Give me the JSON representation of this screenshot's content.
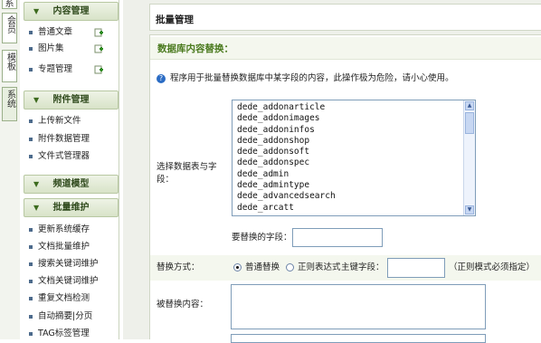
{
  "vertical_tabs": [
    "系",
    "会员",
    "模板",
    "系统"
  ],
  "sidebar": {
    "groups": [
      {
        "title": "内容管理",
        "items": [
          "普通文章",
          "图片集",
          "专题管理"
        ]
      },
      {
        "title": "附件管理",
        "items": [
          "上传新文件",
          "附件数据管理",
          "文件式管理器"
        ]
      },
      {
        "title": "频道模型",
        "items": []
      },
      {
        "title": "批量维护",
        "items": [
          "更新系统缓存",
          "文档批量维护",
          "搜索关键词维护",
          "文档关键词维护",
          "重复文档检测",
          "自动摘要|分页",
          "TAG标签管理"
        ]
      }
    ],
    "collapse_icon": "double-chevron-down-icon",
    "item_icon": "square-bullet-icon",
    "add_icon": "green-plus-icon"
  },
  "page": {
    "title": "批量管理",
    "section_title": "数据库内容替换：",
    "notice": "程序用于批量替换数据库中某字段的内容，此操作极为危险，请小心使用。",
    "notice_icon": "help-icon",
    "select_label": "选择数据表与字段：",
    "tables": [
      "dede_addonarticle",
      "dede_addonimages",
      "dede_addoninfos",
      "dede_addonshop",
      "dede_addonsoft",
      "dede_addonspec",
      "dede_admin",
      "dede_admintype",
      "dede_advancedsearch",
      "dede_arcatt"
    ],
    "field_label": "要替换的字段：",
    "field_value": "",
    "method_label": "替换方式：",
    "method_options": [
      "普通替换",
      "正则表达式"
    ],
    "method_selected": "普通替换",
    "key_field_label": "主键字段：",
    "key_field_value": "",
    "regex_note": "（正则模式必须指定）",
    "replace_content_label": "被替换内容：",
    "replace_content_value": ""
  },
  "colors": {
    "accent_green": "#4a7a1e",
    "header_green": "#d8e3c8",
    "border": "#7f9db9"
  }
}
